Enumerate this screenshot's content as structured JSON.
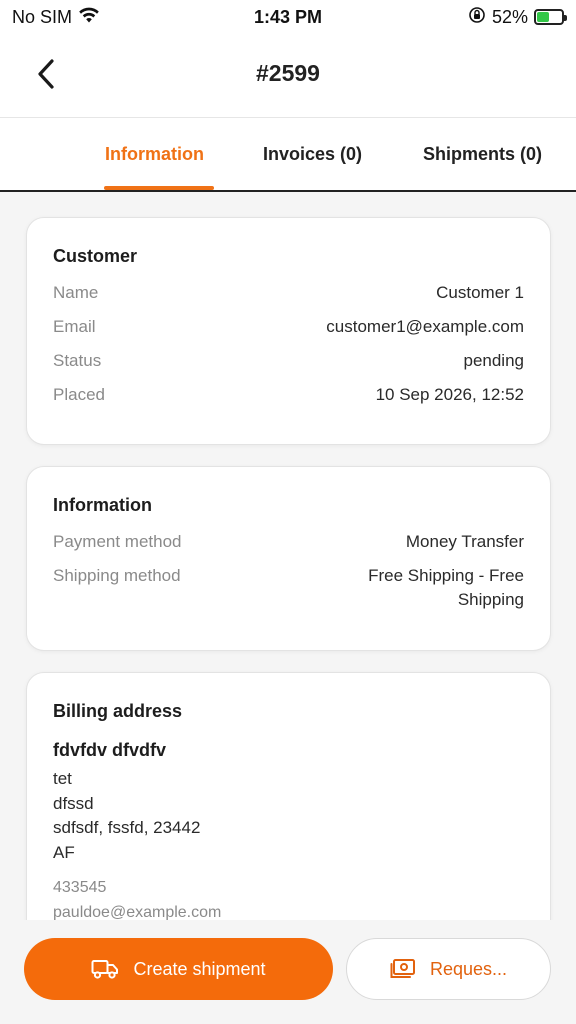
{
  "status_bar": {
    "carrier": "No SIM",
    "time": "1:43 PM",
    "battery": "52%",
    "battery_level": 0.52,
    "icons": [
      "wifi-icon",
      "orientation-lock-icon",
      "battery-charging-icon"
    ]
  },
  "header": {
    "title": "#2599",
    "back_icon": "chevron-left-icon"
  },
  "tabs": [
    {
      "label": "Information",
      "active": true
    },
    {
      "label": "Invoices (0)",
      "active": false
    },
    {
      "label": "Shipments (0)",
      "active": false
    }
  ],
  "customer": {
    "title": "Customer",
    "rows": [
      {
        "label": "Name",
        "value": "Customer 1"
      },
      {
        "label": "Email",
        "value": "customer1@example.com"
      },
      {
        "label": "Status",
        "value": "pending"
      },
      {
        "label": "Placed",
        "value": "10 Sep 2026, 12:52"
      }
    ]
  },
  "information": {
    "title": "Information",
    "rows": [
      {
        "label": "Payment method",
        "value": "Money Transfer"
      },
      {
        "label": "Shipping method",
        "value": "Free Shipping - Free Shipping"
      }
    ]
  },
  "billing": {
    "title": "Billing address",
    "name": "fdvfdv dfvdfv",
    "lines": [
      "tet",
      "dfssd",
      "sdfsdf, fssfd, 23442",
      "AF"
    ],
    "phone": "433545",
    "email": "pauldoe@example.com"
  },
  "actions": {
    "primary_label": "Create shipment",
    "primary_icon": "truck-icon",
    "secondary_label": "Reques...",
    "secondary_icon": "money-icon"
  },
  "colors": {
    "accent": "#f07216",
    "primary_button": "#f46b0b",
    "background": "#f5f5f5"
  }
}
